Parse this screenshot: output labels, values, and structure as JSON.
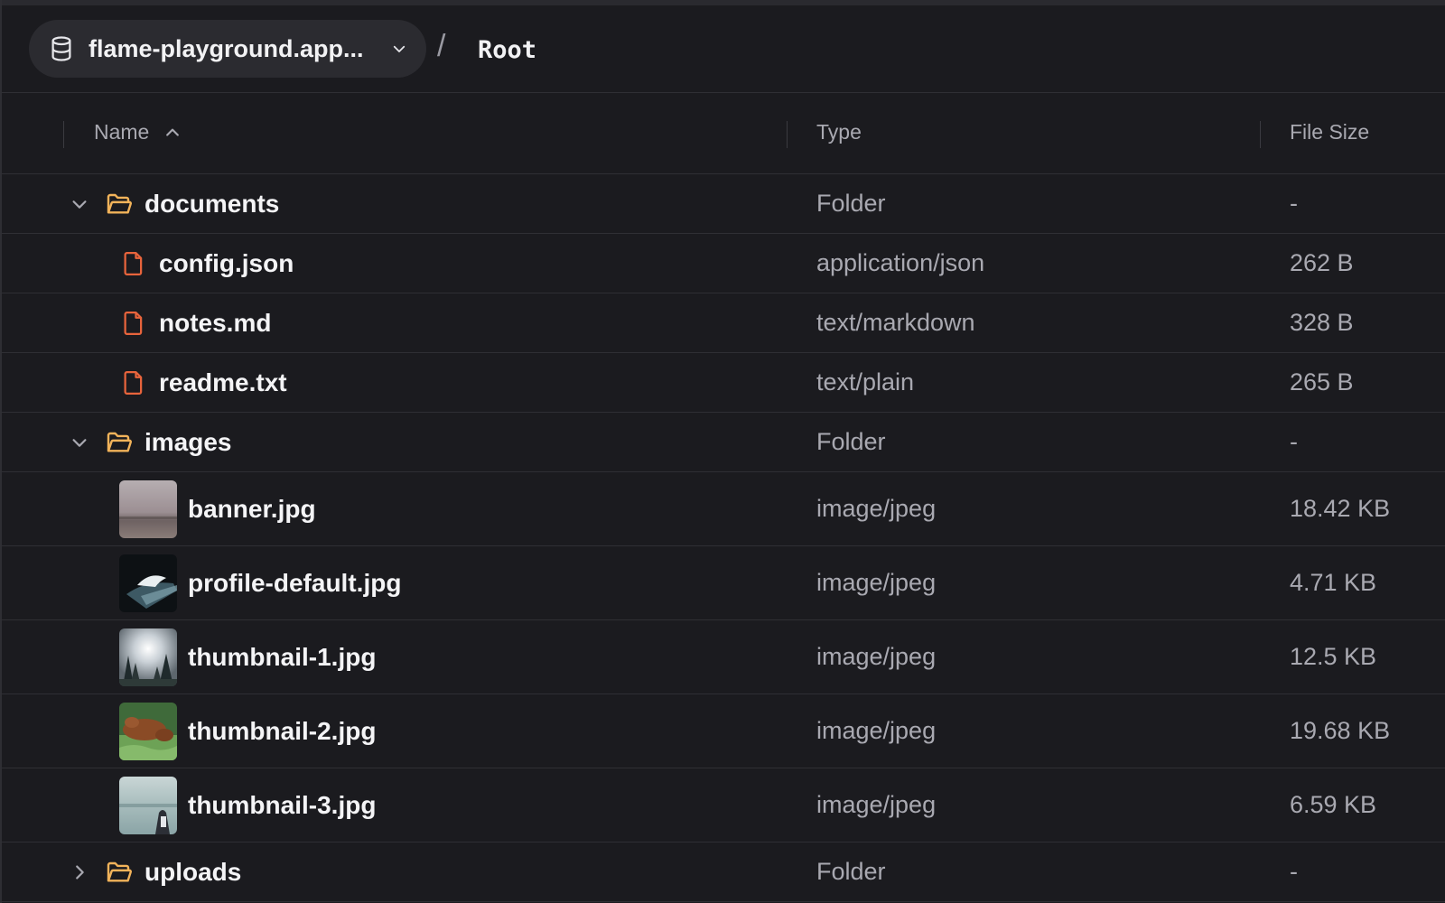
{
  "header": {
    "bucket_name": "flame-playground.app...",
    "separator": "/",
    "current_path": "Root"
  },
  "table": {
    "columns": {
      "name": "Name",
      "type": "Type",
      "size": "File Size"
    },
    "sort": {
      "column": "Name",
      "direction": "ascending"
    }
  },
  "rows": [
    {
      "name": "documents",
      "type": "Folder",
      "size": "-",
      "kind": "folder",
      "expanded": true,
      "icon": "folder-open-icon",
      "icon_color": "#f2b35a"
    },
    {
      "name": "config.json",
      "type": "application/json",
      "size": "262 B",
      "kind": "file",
      "icon": "file-icon",
      "icon_color": "#e8643c"
    },
    {
      "name": "notes.md",
      "type": "text/markdown",
      "size": "328 B",
      "kind": "file",
      "icon": "file-icon",
      "icon_color": "#e8643c"
    },
    {
      "name": "readme.txt",
      "type": "text/plain",
      "size": "265 B",
      "kind": "file",
      "icon": "file-icon",
      "icon_color": "#e8643c"
    },
    {
      "name": "images",
      "type": "Folder",
      "size": "-",
      "kind": "folder",
      "expanded": true,
      "icon": "folder-open-icon",
      "icon_color": "#f2b35a"
    },
    {
      "name": "banner.jpg",
      "type": "image/jpeg",
      "size": "18.42 KB",
      "kind": "image",
      "thumbnail": "misty-landscape"
    },
    {
      "name": "profile-default.jpg",
      "type": "image/jpeg",
      "size": "4.71 KB",
      "kind": "image",
      "thumbnail": "wave-splash"
    },
    {
      "name": "thumbnail-1.jpg",
      "type": "image/jpeg",
      "size": "12.5 KB",
      "kind": "image",
      "thumbnail": "forest-sunburst"
    },
    {
      "name": "thumbnail-2.jpg",
      "type": "image/jpeg",
      "size": "19.68 KB",
      "kind": "image",
      "thumbnail": "dog-on-grass"
    },
    {
      "name": "thumbnail-3.jpg",
      "type": "image/jpeg",
      "size": "6.59 KB",
      "kind": "image",
      "thumbnail": "seaside-post"
    },
    {
      "name": "uploads",
      "type": "Folder",
      "size": "-",
      "kind": "folder",
      "expanded": false,
      "icon": "folder-open-icon",
      "icon_color": "#f2b35a"
    }
  ],
  "colors": {
    "background": "#1b1b1f",
    "pill": "#2b2b30",
    "divider": "#2f2f34",
    "text_primary": "#f4f4f6",
    "text_secondary": "#a9a9b1",
    "folder": "#f2b35a",
    "file": "#e8643c"
  }
}
